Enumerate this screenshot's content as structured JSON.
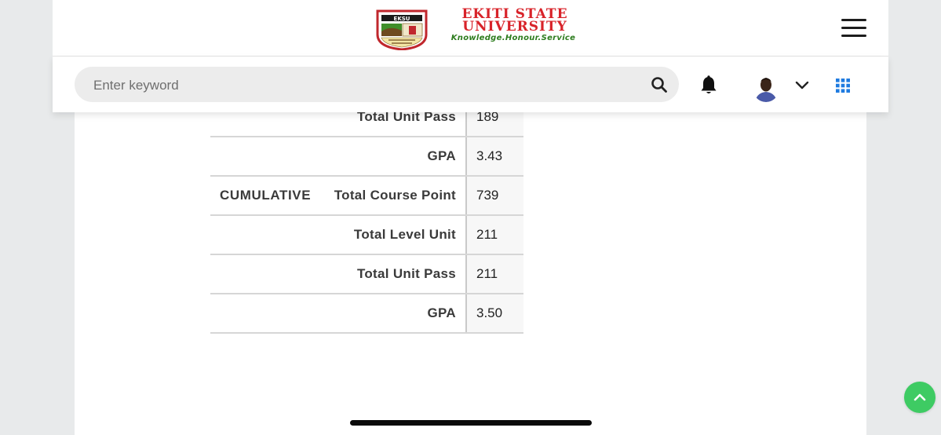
{
  "header": {
    "logo": {
      "name": "EKITI STATE UNIVERSITY",
      "name_line1": "EKITI STATE",
      "name_line2": "UNIVERSITY",
      "emblem_text": "EKSU",
      "motto": "Knowledge.Honour.Service"
    },
    "menu_icon": "hamburger-menu-icon"
  },
  "toolbar": {
    "search": {
      "placeholder": "Enter keyword",
      "value": "",
      "icon": "search-icon"
    },
    "notifications_icon": "bell-icon",
    "avatar_icon": "user-avatar",
    "dropdown_icon": "chevron-down-icon",
    "apps_icon": "grid-apps-icon"
  },
  "results_table": {
    "rows": [
      {
        "section": "",
        "label": "Total Unit Pass",
        "value": "189"
      },
      {
        "section": "",
        "label": "GPA",
        "value": "3.43"
      },
      {
        "section": "CUMULATIVE",
        "label": "Total Course Point",
        "value": "739"
      },
      {
        "section": "",
        "label": "Total Level Unit",
        "value": "211"
      },
      {
        "section": "",
        "label": "Total Unit Pass",
        "value": "211"
      },
      {
        "section": "",
        "label": "GPA",
        "value": "3.50"
      }
    ]
  },
  "scroll_top_icon": "chevron-up-icon",
  "colors": {
    "brand_red": "#d8232a",
    "brand_green": "#2e7d1f",
    "apps_blue": "#1f7be0",
    "scroll_button_green": "#3ecb63",
    "page_background": "#e8eaeb"
  }
}
